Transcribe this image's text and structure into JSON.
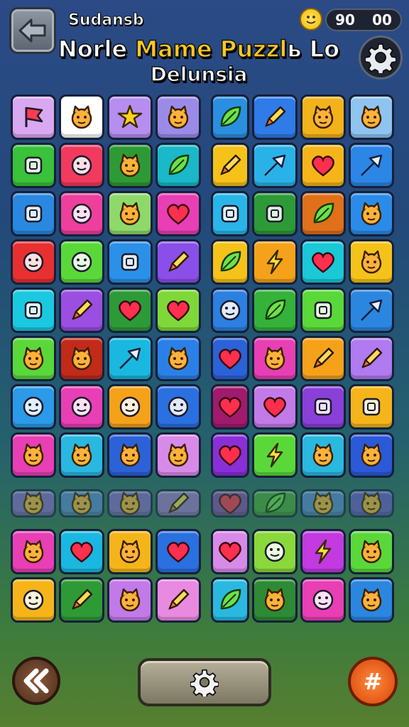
{
  "header": {
    "subtitle": "Sudansb",
    "title_part1": "Norle ",
    "title_part2": "Mame Puzzl",
    "title_part3": "ь Lo",
    "title_line2": "Delunsia",
    "score_left": "90",
    "score_right": "00"
  },
  "bottom": {
    "right_symbol": "#"
  },
  "colors": {
    "accent": "#ffc81f",
    "background_top": "#2b4a86",
    "background_bottom": "#567f2f"
  },
  "tiles": [
    {
      "color": "#d9a8f0",
      "icon": "flag-icon",
      "glyph": "flag"
    },
    {
      "color": "#ffffff",
      "icon": "chef-icon",
      "glyph": "face"
    },
    {
      "color": "#b58ef0",
      "icon": "star-icon",
      "glyph": "star"
    },
    {
      "color": "#9a8be8",
      "icon": "cowboy-icon",
      "glyph": "face"
    },
    {
      "color": "#2a8fe0",
      "icon": "leaf-icon",
      "glyph": "leaf",
      "gap": true
    },
    {
      "color": "#2f7be8",
      "icon": "pen-icon",
      "glyph": "pen"
    },
    {
      "color": "#f2b21a",
      "icon": "lion-icon",
      "glyph": "face"
    },
    {
      "color": "#8fc4f0",
      "icon": "fox-icon",
      "glyph": "face"
    },
    {
      "color": "#39c23a",
      "icon": "gift-icon",
      "glyph": "square"
    },
    {
      "color": "#f23a5e",
      "icon": "smile-icon",
      "glyph": "circle"
    },
    {
      "color": "#2e9a35",
      "icon": "cat-icon",
      "glyph": "face"
    },
    {
      "color": "#1ab8c8",
      "icon": "leaf-icon",
      "glyph": "leaf"
    },
    {
      "color": "#f5c21a",
      "icon": "pen-icon",
      "glyph": "pen",
      "gap": true
    },
    {
      "color": "#2ab2e8",
      "icon": "arrow-icon",
      "glyph": "arrow"
    },
    {
      "color": "#f5b51a",
      "icon": "heart-icon",
      "glyph": "heart"
    },
    {
      "color": "#2b86e6",
      "icon": "arrow-icon",
      "glyph": "arrow"
    },
    {
      "color": "#2a88e0",
      "icon": "bag-icon",
      "glyph": "square"
    },
    {
      "color": "#ee3f9c",
      "icon": "ban-icon",
      "glyph": "circle"
    },
    {
      "color": "#8fd96a",
      "icon": "cat-icon",
      "glyph": "face"
    },
    {
      "color": "#e83fb4",
      "icon": "heart-icon",
      "glyph": "heart"
    },
    {
      "color": "#2ab5e8",
      "icon": "bag-icon",
      "glyph": "square",
      "gap": true
    },
    {
      "color": "#2d9a38",
      "icon": "cube-icon",
      "glyph": "square"
    },
    {
      "color": "#e0701a",
      "icon": "leaf-icon",
      "glyph": "leaf"
    },
    {
      "color": "#2b8be8",
      "icon": "cat-icon",
      "glyph": "face"
    },
    {
      "color": "#e83030",
      "icon": "clock-icon",
      "glyph": "circle"
    },
    {
      "color": "#5ad83a",
      "icon": "close-icon",
      "glyph": "circle"
    },
    {
      "color": "#2b90e8",
      "icon": "note-icon",
      "glyph": "square"
    },
    {
      "color": "#8a4fe8",
      "icon": "feather-icon",
      "glyph": "pen"
    },
    {
      "color": "#f5c21a",
      "icon": "hand-icon",
      "glyph": "leaf",
      "gap": true
    },
    {
      "color": "#f5a21a",
      "icon": "bolt-icon",
      "glyph": "bolt"
    },
    {
      "color": "#1ac8d8",
      "icon": "heart-icon",
      "glyph": "heart"
    },
    {
      "color": "#f5c21a",
      "icon": "monkey-icon",
      "glyph": "face"
    },
    {
      "color": "#1ac8e0",
      "icon": "square-icon",
      "glyph": "square"
    },
    {
      "color": "#9a4fe0",
      "icon": "wand-icon",
      "glyph": "pen"
    },
    {
      "color": "#2d9a38",
      "icon": "heart-icon",
      "glyph": "heart"
    },
    {
      "color": "#7ed83a",
      "icon": "heart-icon",
      "glyph": "heart"
    },
    {
      "color": "#2b80e0",
      "icon": "swirl-icon",
      "glyph": "circle",
      "gap": true
    },
    {
      "color": "#34b23a",
      "icon": "leaf-icon",
      "glyph": "leaf"
    },
    {
      "color": "#5ad83a",
      "icon": "square-icon",
      "glyph": "square"
    },
    {
      "color": "#2b86e0",
      "icon": "pen-icon",
      "glyph": "arrow"
    },
    {
      "color": "#5ad83a",
      "icon": "cat-icon",
      "glyph": "face"
    },
    {
      "color": "#c22a1a",
      "icon": "monster-icon",
      "glyph": "face"
    },
    {
      "color": "#1ab8e0",
      "icon": "arrow-icon",
      "glyph": "arrow"
    },
    {
      "color": "#2b80e8",
      "icon": "frog-icon",
      "glyph": "face"
    },
    {
      "color": "#2b62d8",
      "icon": "heart-icon",
      "glyph": "heart",
      "gap": true
    },
    {
      "color": "#e83fb4",
      "icon": "cat-icon",
      "glyph": "face"
    },
    {
      "color": "#f5a21a",
      "icon": "wrench-icon",
      "glyph": "pen"
    },
    {
      "color": "#b07af0",
      "icon": "wand-icon",
      "glyph": "pen"
    },
    {
      "color": "#2b9ae8",
      "icon": "bell-icon",
      "glyph": "circle"
    },
    {
      "color": "#e83fb4",
      "icon": "smile-icon",
      "glyph": "circle"
    },
    {
      "color": "#f5a21a",
      "icon": "smile-icon",
      "glyph": "circle"
    },
    {
      "color": "#2b70e0",
      "icon": "ring-icon",
      "glyph": "circle"
    },
    {
      "color": "#a01a6e",
      "icon": "heart-icon",
      "glyph": "heart",
      "gap": true
    },
    {
      "color": "#c27ae8",
      "icon": "heart-icon",
      "glyph": "heart"
    },
    {
      "color": "#8a3fd8",
      "icon": "letter-icon",
      "glyph": "square"
    },
    {
      "color": "#f5b51a",
      "icon": "hexagon-icon",
      "glyph": "square"
    },
    {
      "color": "#e83fb4",
      "icon": "cat-icon",
      "glyph": "face"
    },
    {
      "color": "#2ab8e0",
      "icon": "cat-icon",
      "glyph": "face"
    },
    {
      "color": "#2b62d8",
      "icon": "frog-icon",
      "glyph": "face"
    },
    {
      "color": "#d88ae8",
      "icon": "fox-icon",
      "glyph": "face"
    },
    {
      "color": "#8a2fd8",
      "icon": "heart-icon",
      "glyph": "heart",
      "gap": true
    },
    {
      "color": "#5ad83a",
      "icon": "bolt-icon",
      "glyph": "bolt"
    },
    {
      "color": "#2ab8e0",
      "icon": "cat-icon",
      "glyph": "face"
    },
    {
      "color": "#2b5ad8",
      "icon": "cat-icon",
      "glyph": "face"
    },
    {
      "color": "#8a6ad0",
      "icon": "cat-icon",
      "glyph": "face",
      "faded": true
    },
    {
      "color": "#5a8ad8",
      "icon": "cat-icon",
      "glyph": "face",
      "faded": true
    },
    {
      "color": "#8a6ad0",
      "icon": "frog-icon",
      "glyph": "face",
      "faded": true
    },
    {
      "color": "#a07ad0",
      "icon": "wand-icon",
      "glyph": "pen",
      "faded": true
    },
    {
      "color": "#8a4ab0",
      "icon": "heart-icon",
      "glyph": "heart",
      "faded": true,
      "gap": true
    },
    {
      "color": "#4aa83a",
      "icon": "leaf-icon",
      "glyph": "leaf",
      "faded": true
    },
    {
      "color": "#5a8ad8",
      "icon": "cat-icon",
      "glyph": "face",
      "faded": true
    },
    {
      "color": "#6a5ad0",
      "icon": "cat-icon",
      "glyph": "face",
      "faded": true
    },
    {
      "color": "#e83fb4",
      "icon": "cat-icon",
      "glyph": "face"
    },
    {
      "color": "#1ab8e0",
      "icon": "heart-icon",
      "glyph": "heart"
    },
    {
      "color": "#f5b51a",
      "icon": "cat-icon",
      "glyph": "face"
    },
    {
      "color": "#2b70e0",
      "icon": "heart-icon",
      "glyph": "heart"
    },
    {
      "color": "#d88ae8",
      "icon": "heart-icon",
      "glyph": "heart",
      "gap": true
    },
    {
      "color": "#8ad83a",
      "icon": "smile-icon",
      "glyph": "circle"
    },
    {
      "color": "#c23ae0",
      "icon": "bolt-icon",
      "glyph": "bolt"
    },
    {
      "color": "#5ad83a",
      "icon": "pig-icon",
      "glyph": "face"
    },
    {
      "color": "#f5b51a",
      "icon": "arrow-icon",
      "glyph": "circle"
    },
    {
      "color": "#2e9a35",
      "icon": "pen-icon",
      "glyph": "pen"
    },
    {
      "color": "#c27ae8",
      "icon": "cat-icon",
      "glyph": "face"
    },
    {
      "color": "#e88ae0",
      "icon": "pen-icon",
      "glyph": "pen"
    },
    {
      "color": "#2ab8e0",
      "icon": "leaf-icon",
      "glyph": "leaf",
      "gap": true
    },
    {
      "color": "#2e8a35",
      "icon": "frog-icon",
      "glyph": "face"
    },
    {
      "color": "#e83fb4",
      "icon": "pie-icon",
      "glyph": "circle"
    },
    {
      "color": "#2b86e0",
      "icon": "monster-icon",
      "glyph": "face"
    }
  ]
}
